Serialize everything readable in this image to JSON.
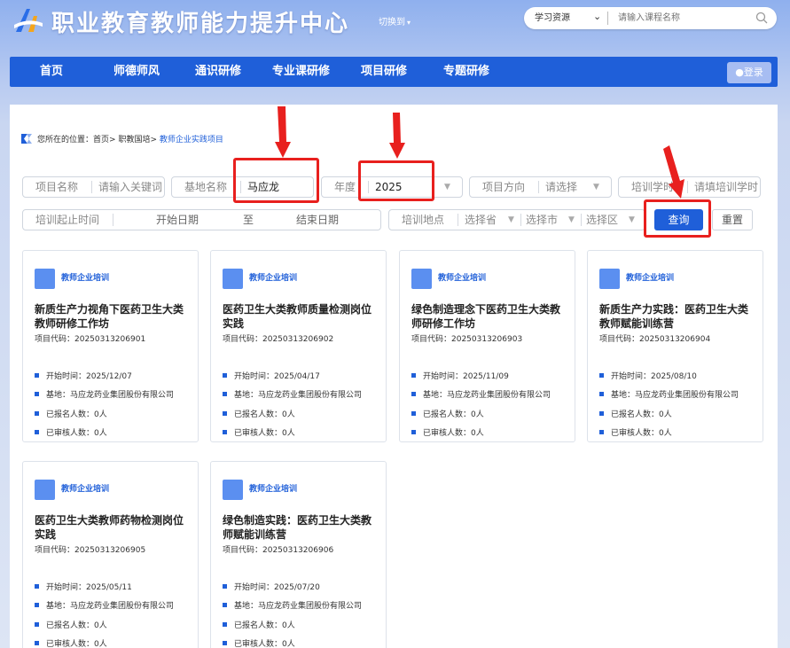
{
  "header": {
    "site_title": "职业教育教师能力提升中心",
    "switch_label": "切换到",
    "search": {
      "select_value": "学习资源",
      "placeholder": "请输入课程名称"
    }
  },
  "nav": {
    "items": [
      {
        "label": "首页"
      },
      {
        "label": "师德师风"
      },
      {
        "label": "通识研修"
      },
      {
        "label": "专业课研修"
      },
      {
        "label": "项目研修"
      },
      {
        "label": "专题研修"
      }
    ],
    "login_label": "登录"
  },
  "breadcrumb": {
    "prefix": "您所在的位置：",
    "home": "首页",
    "sep": ">",
    "level2": "职教国培",
    "current": "教师企业实践项目"
  },
  "filters": {
    "project_name": {
      "label": "项目名称",
      "placeholder": "请输入关键词"
    },
    "base_name": {
      "label": "基地名称",
      "value": "马应龙"
    },
    "year": {
      "label": "年度",
      "value": "2025"
    },
    "direction": {
      "label": "项目方向",
      "placeholder": "请选择"
    },
    "hours": {
      "label": "培训学时",
      "placeholder": "请填培训学时"
    },
    "period": {
      "label": "培训起止时间",
      "start_placeholder": "开始日期",
      "to": "至",
      "end_placeholder": "结束日期"
    },
    "location": {
      "label": "培训地点",
      "province": "选择省",
      "city": "选择市",
      "district": "选择区"
    },
    "query_label": "查询",
    "reset_label": "重置"
  },
  "cards": [
    {
      "tag": "教师企业培训",
      "title": "新质生产力视角下医药卫生大类教师研修工作坊",
      "code": "项目代码：20250313206901",
      "start": "开始时间：2025/12/07",
      "base": "基地：马应龙药业集团股份有限公司",
      "enrolled": "已报名人数：0人",
      "reviewed": "已审核人数：0人"
    },
    {
      "tag": "教师企业培训",
      "title": "医药卫生大类教师质量检测岗位实践",
      "code": "项目代码：20250313206902",
      "start": "开始时间：2025/04/17",
      "base": "基地：马应龙药业集团股份有限公司",
      "enrolled": "已报名人数：0人",
      "reviewed": "已审核人数：0人"
    },
    {
      "tag": "教师企业培训",
      "title": "绿色制造理念下医药卫生大类教师研修工作坊",
      "code": "项目代码：20250313206903",
      "start": "开始时间：2025/11/09",
      "base": "基地：马应龙药业集团股份有限公司",
      "enrolled": "已报名人数：0人",
      "reviewed": "已审核人数：0人"
    },
    {
      "tag": "教师企业培训",
      "title": "新质生产力实践：医药卫生大类教师赋能训练营",
      "code": "项目代码：20250313206904",
      "start": "开始时间：2025/08/10",
      "base": "基地：马应龙药业集团股份有限公司",
      "enrolled": "已报名人数：0人",
      "reviewed": "已审核人数：0人"
    },
    {
      "tag": "教师企业培训",
      "title": "医药卫生大类教师药物检测岗位实践",
      "code": "项目代码：20250313206905",
      "start": "开始时间：2025/05/11",
      "base": "基地：马应龙药业集团股份有限公司",
      "enrolled": "已报名人数：0人",
      "reviewed": "已审核人数：0人"
    },
    {
      "tag": "教师企业培训",
      "title": "绿色制造实践：医药卫生大类教师赋能训练营",
      "code": "项目代码：20250313206906",
      "start": "开始时间：2025/07/20",
      "base": "基地：马应龙药业集团股份有限公司",
      "enrolled": "已报名人数：0人",
      "reviewed": "已审核人数：0人"
    }
  ],
  "colors": {
    "primary": "#1f5fd9",
    "highlight": "#e8201e",
    "card_border": "#dde2ea"
  }
}
